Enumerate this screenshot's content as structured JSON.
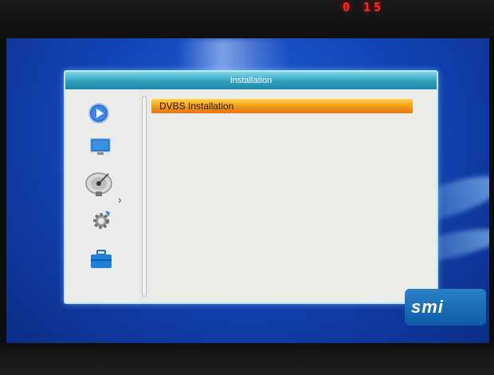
{
  "led_clock": "0 15",
  "dialog": {
    "title": "Installation",
    "items": [
      {
        "label": "DVBS Installation",
        "selected": true
      }
    ]
  },
  "sidebar": {
    "icons": [
      "play-icon",
      "monitor-icon",
      "satellite-dish-icon",
      "settings-gear-icon",
      "toolbox-icon"
    ],
    "active_index": 2
  },
  "logo": {
    "text": "smi"
  },
  "colors": {
    "screen_blue": "#1345b8",
    "titlebar": "#2f9fbf",
    "highlight": "#f29a18",
    "panel": "#e9e9e7"
  }
}
